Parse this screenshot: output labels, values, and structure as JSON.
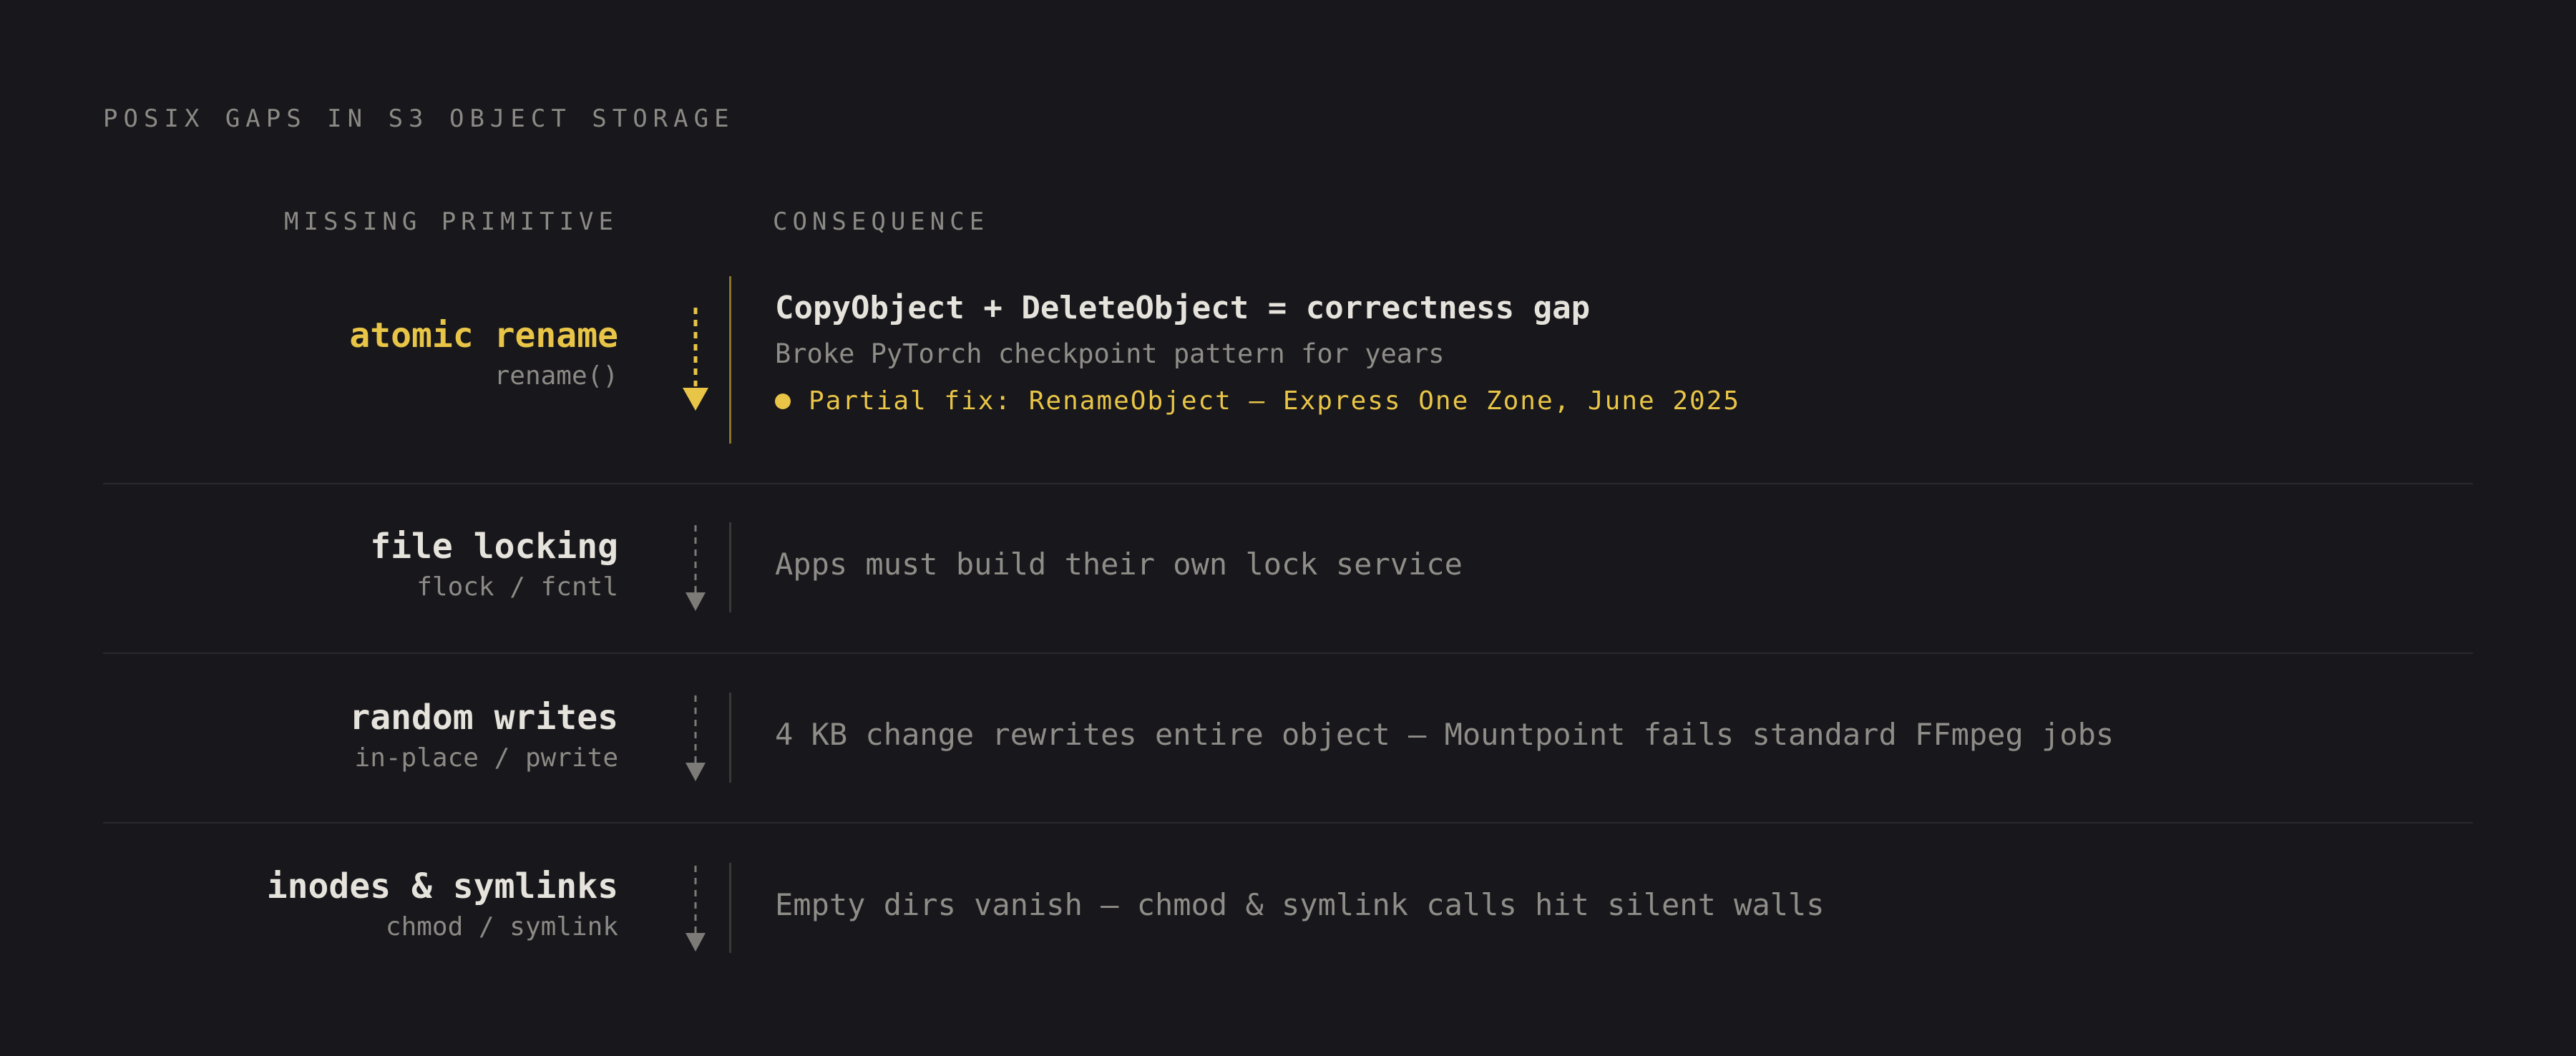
{
  "title": "POSIX GAPS IN S3 OBJECT STORAGE",
  "headers": {
    "left": "MISSING PRIMITIVE",
    "right": "CONSEQUENCE"
  },
  "colors": {
    "background": "#18171b",
    "accent": "#e8c547",
    "text_primary": "#e6e3dc",
    "text_muted": "#8f8d88"
  },
  "rows": [
    {
      "name": "atomic rename",
      "call": "rename()",
      "highlighted": true,
      "headline": "CopyObject + DeleteObject = correctness gap",
      "detail": "Broke PyTorch checkpoint pattern for years",
      "fix": "Partial fix: RenameObject — Express One Zone, June 2025"
    },
    {
      "name": "file locking",
      "call": "flock / fcntl",
      "consequence": "Apps must build their own lock service"
    },
    {
      "name": "random writes",
      "call": "in-place / pwrite",
      "consequence": "4 KB change rewrites entire object — Mountpoint fails standard FFmpeg jobs"
    },
    {
      "name": "inodes & symlinks",
      "call": "chmod / symlink",
      "consequence": "Empty dirs vanish — chmod & symlink calls hit silent walls"
    }
  ]
}
